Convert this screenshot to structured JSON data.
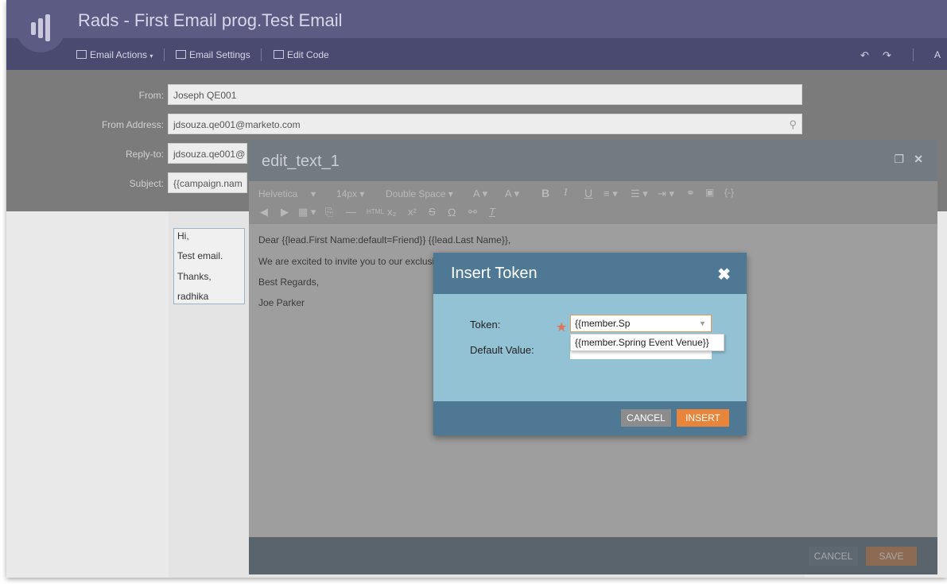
{
  "app": {
    "title": "Rads - First Email prog.Test Email"
  },
  "toolbar": {
    "email_actions": "Email Actions",
    "email_settings": "Email Settings",
    "edit_code": "Edit Code",
    "right_text": "A"
  },
  "form": {
    "from_label": "From:",
    "from_value": "Joseph QE001",
    "from_address_label": "From Address:",
    "from_address_value": "jdsouza.qe001@marketo.com",
    "reply_to_label": "Reply-to:",
    "reply_to_value": "jdsouza.qe001@",
    "subject_label": "Subject:",
    "subject_value": "{{campaign.nam"
  },
  "email_preview": {
    "lines": [
      "Hi,",
      "Test email.",
      "Thanks,",
      "radhika"
    ]
  },
  "editor": {
    "title": "edit_text_1",
    "font": "Helvetica",
    "size": "14px",
    "spacing": "Double Space",
    "body_lines": [
      "Dear {{lead.First Name:default=Friend}} {{lead.Last Name}},",
      "We are excited to invite you to our exclusi",
      "Best Regards,",
      "Joe Parker"
    ],
    "cancel": "CANCEL",
    "save": "SAVE"
  },
  "dialog": {
    "title": "Insert Token",
    "token_label": "Token:",
    "token_value": "{{member.Sp",
    "default_label": "Default Value:",
    "suggestion": "{{member.Spring Event Venue}}",
    "cancel": "CANCEL",
    "insert": "INSERT"
  },
  "colors": {
    "header": "#5c5b84",
    "dialog_header": "#4e7893",
    "dialog_body": "#93c2d5",
    "insert_button": "#e8853a",
    "cancel_button": "#8c8c8c"
  }
}
